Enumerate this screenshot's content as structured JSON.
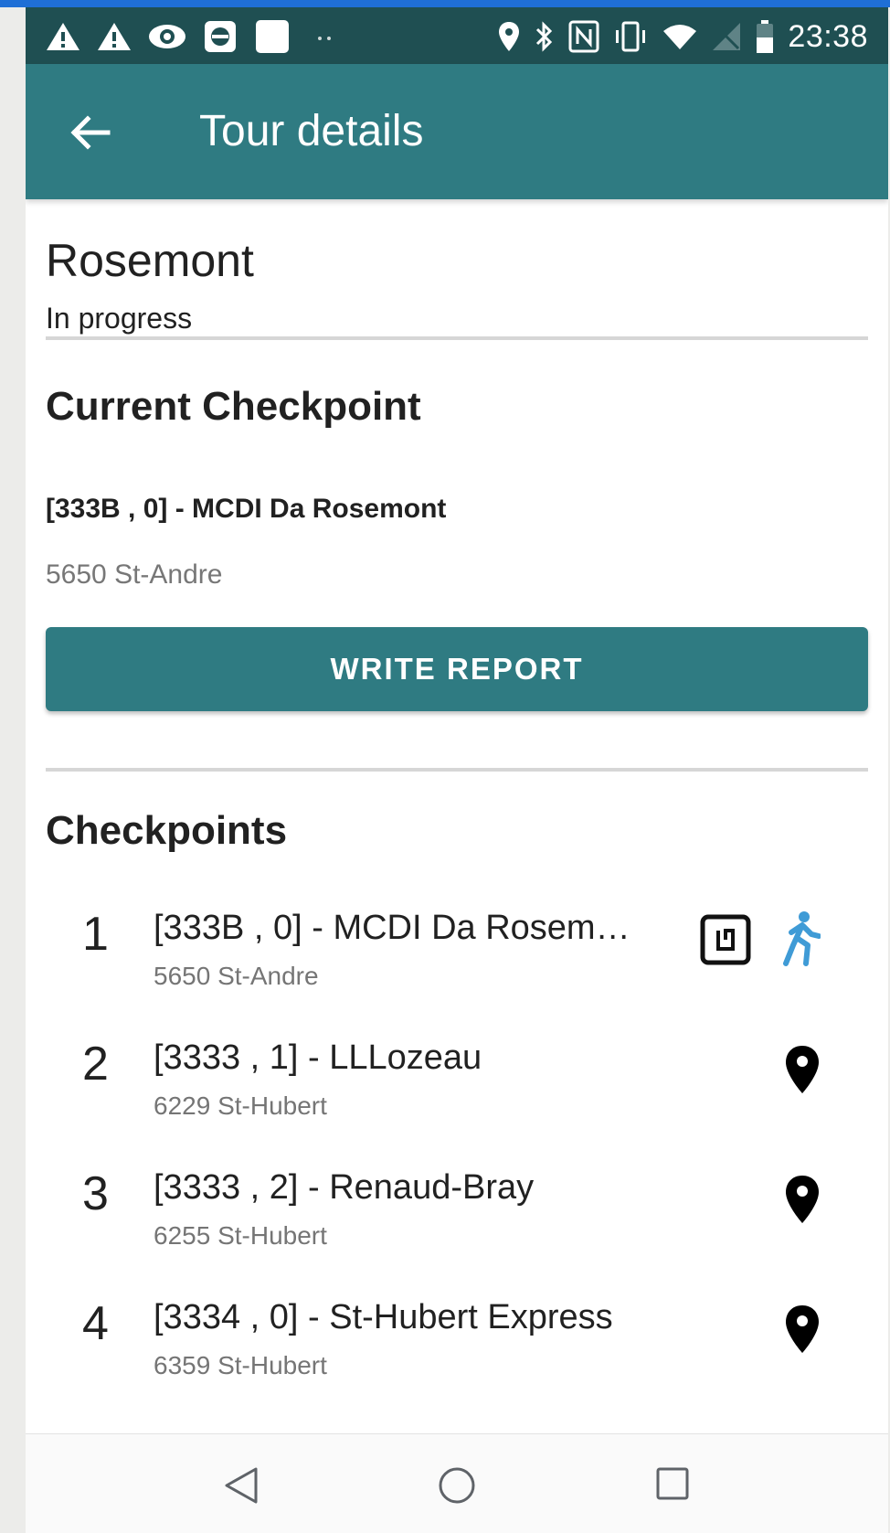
{
  "status_bar": {
    "time": "23:38",
    "icons": [
      "warning-icon",
      "warning-icon",
      "eye-icon",
      "cast-icon",
      "blank-notification-icon",
      "more-dots-icon",
      "location-icon",
      "bluetooth-icon",
      "nfc-icon",
      "vibrate-icon",
      "wifi-icon",
      "no-sim-icon",
      "battery-icon"
    ]
  },
  "app_bar": {
    "title": "Tour details",
    "back_icon": "arrow-back-icon"
  },
  "tour": {
    "name": "Rosemont",
    "status": "In progress"
  },
  "current_checkpoint": {
    "section_title": "Current Checkpoint",
    "name": "[333B , 0] - MCDI Da Rosemont",
    "address": "5650 St-Andre",
    "button_label": "WRITE REPORT"
  },
  "checkpoints": {
    "section_title": "Checkpoints",
    "items": [
      {
        "num": "1",
        "name": "[333B , 0] - MCDI Da Rosem…",
        "address": "5650 St-Andre",
        "icons": [
          "nfc-tag-icon",
          "walking-person-icon"
        ]
      },
      {
        "num": "2",
        "name": "[3333 , 1] - LLLozeau",
        "address": "6229 St-Hubert",
        "icons": [
          "map-pin-icon"
        ]
      },
      {
        "num": "3",
        "name": "[3333 , 2] - Renaud-Bray",
        "address": "6255 St-Hubert",
        "icons": [
          "map-pin-icon"
        ]
      },
      {
        "num": "4",
        "name": "[3334 , 0] - St-Hubert Express",
        "address": "6359 St-Hubert",
        "icons": [
          "map-pin-icon"
        ]
      }
    ]
  },
  "nav_bar": {
    "icons": [
      "back-triangle-icon",
      "home-circle-icon",
      "recents-square-icon"
    ]
  },
  "colors": {
    "app_bar": "#2f7b82",
    "status_bar": "#1f4f52",
    "button": "#2f7b82",
    "active_icon": "#3f9bd6"
  }
}
